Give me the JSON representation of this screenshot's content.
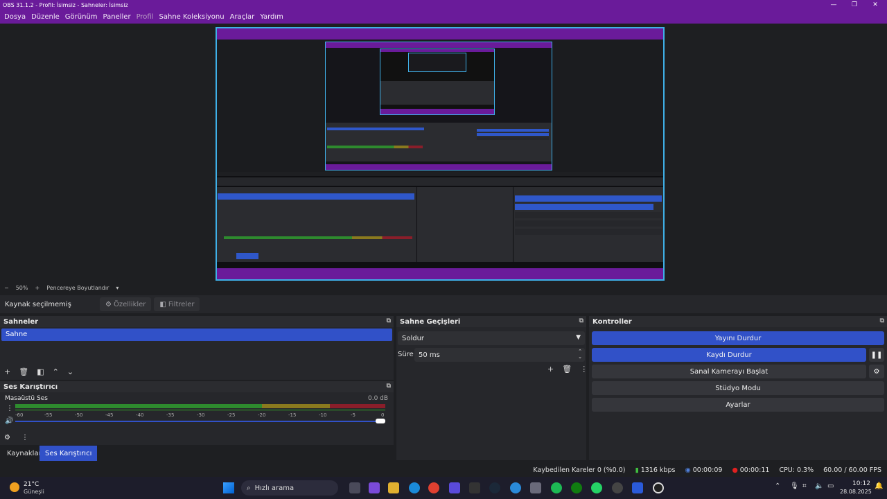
{
  "window": {
    "title": "OBS 31.1.2 - Profil: İsimsiz - Sahneler: İsimsiz",
    "minimize": "—",
    "maximize": "❐",
    "close": "✕"
  },
  "menu": [
    "Dosya",
    "Düzenle",
    "Görünüm",
    "Paneller",
    "Profil",
    "Sahne Koleksiyonu",
    "Araçlar",
    "Yardım"
  ],
  "zoom": {
    "minus": "−",
    "value": "50%",
    "plus": "+",
    "mode": "Pencereye Boyutlandır",
    "caret": "▾"
  },
  "source_toolbar": {
    "no_source": "Kaynak seçilmemiş",
    "properties": "Özellikler",
    "filters": "Filtreler"
  },
  "scenes": {
    "title": "Sahneler",
    "items": [
      "Sahne"
    ],
    "pop_icon": "⧉"
  },
  "audio_mixer": {
    "title": "Ses Karıştırıcı",
    "channel": "Masaüstü Ses",
    "level": "0.0 dB",
    "ticks": [
      "-60",
      "-55",
      "-50",
      "-45",
      "-40",
      "-35",
      "-30",
      "-25",
      "-20",
      "-15",
      "-10",
      "-5",
      "0"
    ]
  },
  "tabs": {
    "sources": "Kaynaklar",
    "mixer": "Ses Karıştırıcı"
  },
  "transitions": {
    "title": "Sahne Geçişleri",
    "selected": "Soldur",
    "duration_label": "Süre",
    "duration_value": "50 ms"
  },
  "controls": {
    "title": "Kontroller",
    "stop_stream": "Yayını Durdur",
    "stop_recording": "Kaydı Durdur",
    "virtual_cam": "Sanal Kamerayı Başlat",
    "studio_mode": "Stüdyo Modu",
    "settings": "Ayarlar"
  },
  "status": {
    "dropped": "Kaybedilen Kareler 0 (%0.0)",
    "bitrate": "1316 kbps",
    "stream_time": "00:00:09",
    "rec_time": "00:00:11",
    "cpu": "CPU: 0.3%",
    "fps": "60.00 / 60.00 FPS"
  },
  "taskbar": {
    "weather_temp": "21°C",
    "weather_desc": "Güneşli",
    "search": "Hızlı arama",
    "time": "10:12",
    "date": "28.08.2025"
  },
  "colors": {
    "accent": "#3151c8",
    "title_bar": "#6a1b9a",
    "canvas_border": "#3fb0e8",
    "meter_green": "#2e8b2e",
    "meter_yellow": "#8a7a1e",
    "meter_red": "#8a1e2a"
  }
}
